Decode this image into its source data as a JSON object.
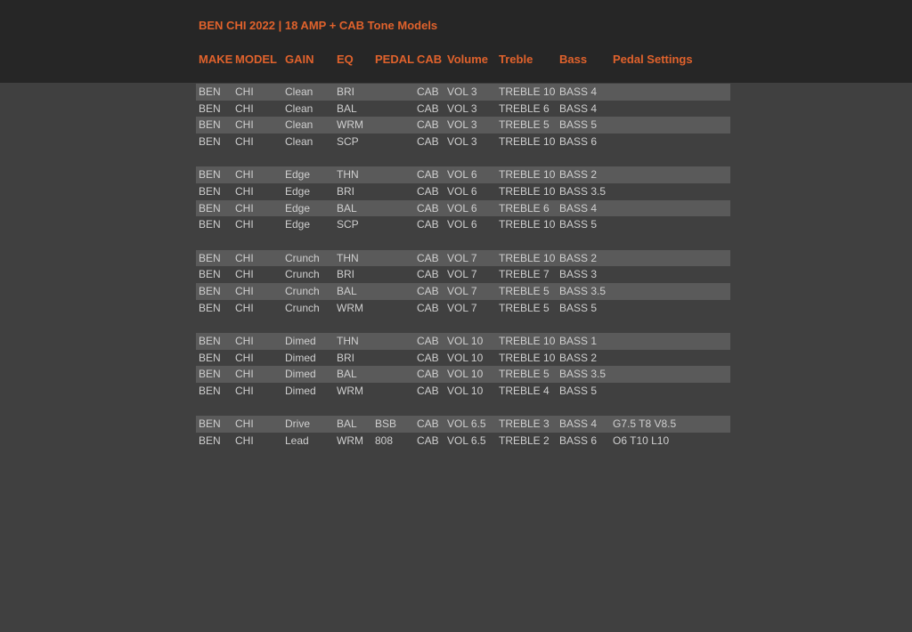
{
  "title": "BEN CHI 2022 | 18 AMP + CAB Tone Models",
  "colors": {
    "header_bg": "#262626",
    "page_bg": "#404040",
    "row_shade": "#5a5a5a",
    "accent": "#e0622c",
    "text": "#cfcfcf"
  },
  "headers": {
    "make": "MAKE",
    "model": "MODEL",
    "gain": "GAIN",
    "eq": "EQ",
    "pedal": "PEDAL",
    "cab": "CAB",
    "volume": "Volume",
    "treble": "Treble",
    "bass": "Bass",
    "settings": "Pedal Settings"
  },
  "rows": [
    {
      "make": "BEN",
      "model": "CHI",
      "gain": "Clean",
      "eq": "BRI",
      "pedal": "",
      "cab": "CAB",
      "vol": "VOL 3",
      "treble": "TREBLE 10",
      "bass": "BASS 4",
      "set": "",
      "shade": true
    },
    {
      "make": "BEN",
      "model": "CHI",
      "gain": "Clean",
      "eq": "BAL",
      "pedal": "",
      "cab": "CAB",
      "vol": "VOL 3",
      "treble": "TREBLE 6",
      "bass": "BASS 4",
      "set": "",
      "shade": false
    },
    {
      "make": "BEN",
      "model": "CHI",
      "gain": "Clean",
      "eq": "WRM",
      "pedal": "",
      "cab": "CAB",
      "vol": "VOL 3",
      "treble": "TREBLE 5",
      "bass": "BASS 5",
      "set": "",
      "shade": true
    },
    {
      "make": "BEN",
      "model": "CHI",
      "gain": "Clean",
      "eq": "SCP",
      "pedal": "",
      "cab": "CAB",
      "vol": "VOL 3",
      "treble": "TREBLE 10",
      "bass": "BASS 6",
      "set": "",
      "shade": false
    },
    {
      "spacer": true
    },
    {
      "make": "BEN",
      "model": "CHI",
      "gain": "Edge",
      "eq": "THN",
      "pedal": "",
      "cab": "CAB",
      "vol": "VOL 6",
      "treble": "TREBLE 10",
      "bass": "BASS 2",
      "set": "",
      "shade": true
    },
    {
      "make": "BEN",
      "model": "CHI",
      "gain": "Edge",
      "eq": "BRI",
      "pedal": "",
      "cab": "CAB",
      "vol": "VOL 6",
      "treble": "TREBLE 10",
      "bass": "BASS 3.5",
      "set": "",
      "shade": false
    },
    {
      "make": "BEN",
      "model": "CHI",
      "gain": "Edge",
      "eq": "BAL",
      "pedal": "",
      "cab": "CAB",
      "vol": "VOL 6",
      "treble": "TREBLE 6",
      "bass": "BASS 4",
      "set": "",
      "shade": true
    },
    {
      "make": "BEN",
      "model": "CHI",
      "gain": "Edge",
      "eq": "SCP",
      "pedal": "",
      "cab": "CAB",
      "vol": "VOL 6",
      "treble": "TREBLE 10",
      "bass": "BASS 5",
      "set": "",
      "shade": false
    },
    {
      "spacer": true
    },
    {
      "make": "BEN",
      "model": "CHI",
      "gain": "Crunch",
      "eq": "THN",
      "pedal": "",
      "cab": "CAB",
      "vol": "VOL 7",
      "treble": "TREBLE 10",
      "bass": "BASS 2",
      "set": "",
      "shade": true
    },
    {
      "make": "BEN",
      "model": "CHI",
      "gain": "Crunch",
      "eq": "BRI",
      "pedal": "",
      "cab": "CAB",
      "vol": "VOL 7",
      "treble": "TREBLE 7",
      "bass": "BASS 3",
      "set": "",
      "shade": false
    },
    {
      "make": "BEN",
      "model": "CHI",
      "gain": "Crunch",
      "eq": "BAL",
      "pedal": "",
      "cab": "CAB",
      "vol": "VOL 7",
      "treble": "TREBLE 5",
      "bass": "BASS 3.5",
      "set": "",
      "shade": true
    },
    {
      "make": "BEN",
      "model": "CHI",
      "gain": "Crunch",
      "eq": "WRM",
      "pedal": "",
      "cab": "CAB",
      "vol": "VOL 7",
      "treble": "TREBLE 5",
      "bass": "BASS 5",
      "set": "",
      "shade": false
    },
    {
      "spacer": true
    },
    {
      "make": "BEN",
      "model": "CHI",
      "gain": "Dimed",
      "eq": "THN",
      "pedal": "",
      "cab": "CAB",
      "vol": "VOL 10",
      "treble": "TREBLE 10",
      "bass": "BASS 1",
      "set": "",
      "shade": true
    },
    {
      "make": "BEN",
      "model": "CHI",
      "gain": "Dimed",
      "eq": "BRI",
      "pedal": "",
      "cab": "CAB",
      "vol": "VOL 10",
      "treble": "TREBLE 10",
      "bass": "BASS 2",
      "set": "",
      "shade": false
    },
    {
      "make": "BEN",
      "model": "CHI",
      "gain": "Dimed",
      "eq": "BAL",
      "pedal": "",
      "cab": "CAB",
      "vol": "VOL 10",
      "treble": "TREBLE 5",
      "bass": "BASS 3.5",
      "set": "",
      "shade": true
    },
    {
      "make": "BEN",
      "model": "CHI",
      "gain": "Dimed",
      "eq": "WRM",
      "pedal": "",
      "cab": "CAB",
      "vol": "VOL 10",
      "treble": "TREBLE 4",
      "bass": "BASS 5",
      "set": "",
      "shade": false
    },
    {
      "spacer": true
    },
    {
      "make": "BEN",
      "model": "CHI",
      "gain": "Drive",
      "eq": "BAL",
      "pedal": "BSB",
      "cab": "CAB",
      "vol": "VOL 6.5",
      "treble": "TREBLE 3",
      "bass": "BASS 4",
      "set": "G7.5 T8 V8.5",
      "shade": true
    },
    {
      "make": "BEN",
      "model": "CHI",
      "gain": "Lead",
      "eq": "WRM",
      "pedal": "808",
      "cab": "CAB",
      "vol": "VOL 6.5",
      "treble": "TREBLE 2",
      "bass": "BASS 6",
      "set": "O6 T10 L10",
      "shade": false
    }
  ]
}
